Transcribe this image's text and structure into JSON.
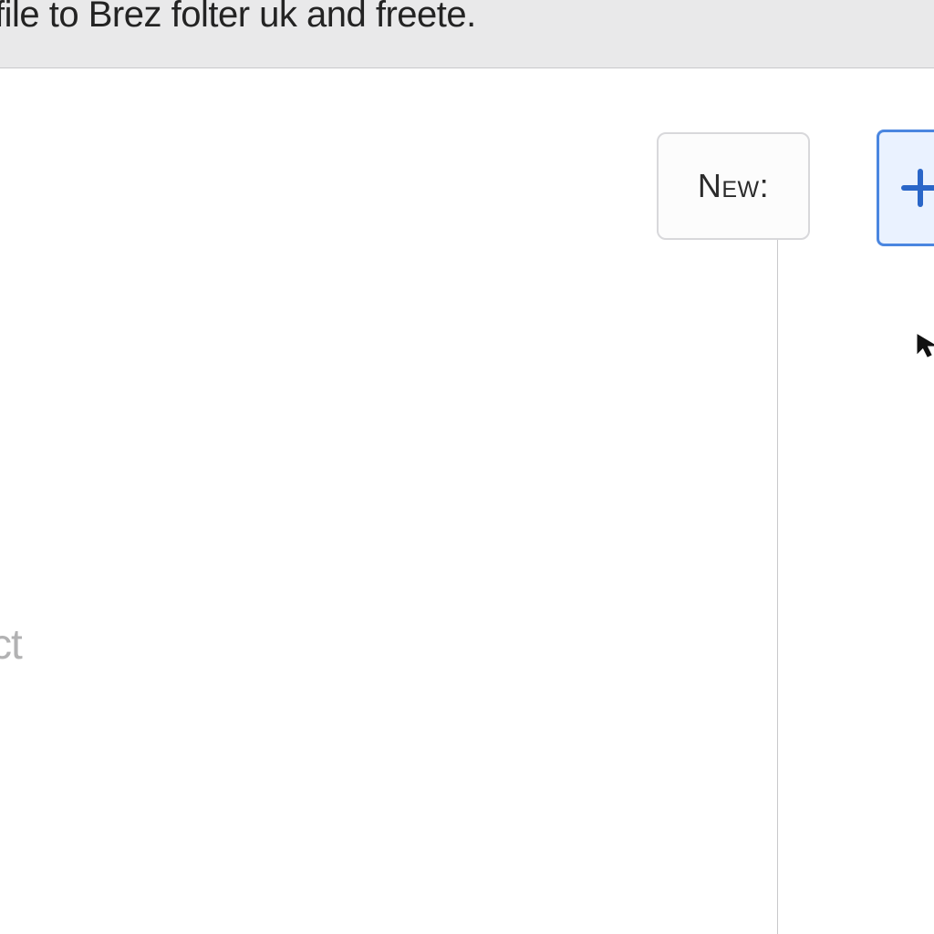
{
  "header": {
    "instruction_fragment": "ii's file to Brez folter uk and freete."
  },
  "toolbar": {
    "new_label": "New:"
  },
  "icons": {
    "plus": "plus-icon",
    "cursor": "cursor-icon"
  },
  "left_panel": {
    "placeholder_fragment": "ct"
  },
  "colors": {
    "accent_blue": "#4a86e0",
    "accent_blue_bg": "#eaf2ff",
    "border_gray": "#d8d8db",
    "header_bg": "#e9e9ea"
  }
}
